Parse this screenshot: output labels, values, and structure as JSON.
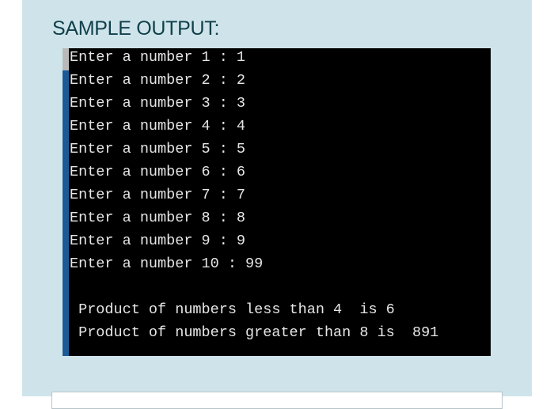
{
  "heading": "SAMPLE OUTPUT:",
  "terminal": {
    "background": "#000000",
    "text_color": "#e6e6e6",
    "lines": [
      "Enter a number 1 : 1",
      "Enter a number 2 : 2",
      "Enter a number 3 : 3",
      "Enter a number 4 : 4",
      "Enter a number 5 : 5",
      "Enter a number 6 : 6",
      "Enter a number 7 : 7",
      "Enter a number 8 : 8",
      "Enter a number 9 : 9",
      "Enter a number 10 : 99",
      "",
      " Product of numbers less than 4  is 6",
      " Product of numbers greater than 8 is  891"
    ]
  },
  "colors": {
    "panel": "#cfe4ea",
    "heading": "#0f3f4a",
    "terminal_edge": "#1c5a97"
  }
}
